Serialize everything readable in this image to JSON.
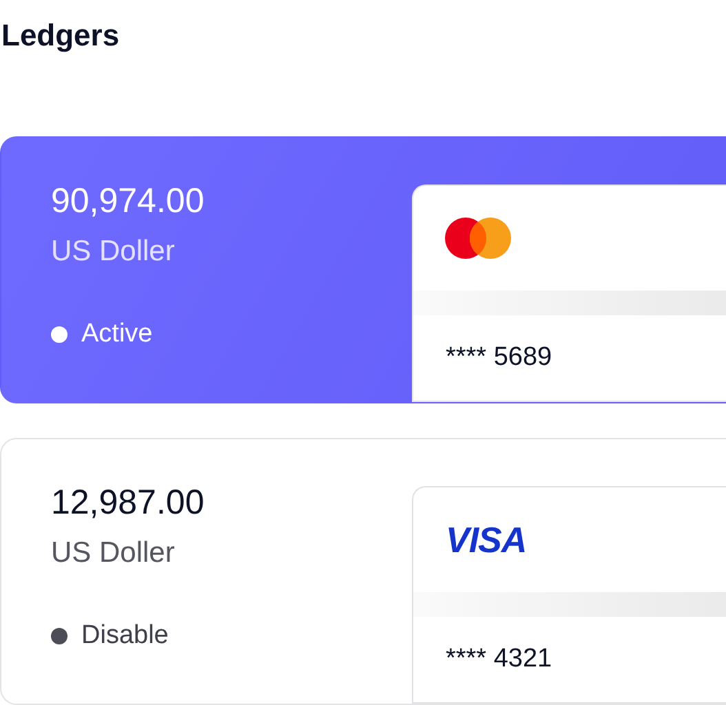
{
  "title": "Ledgers",
  "ledgers": [
    {
      "amount": "90,974.00",
      "currency": "US Doller",
      "status": "Active",
      "selected": true,
      "card": {
        "kind": "mastercard",
        "number": "**** 5689"
      }
    },
    {
      "amount": "12,987.00",
      "currency": "US Doller",
      "status": "Disable",
      "selected": false,
      "card": {
        "kind": "visa",
        "logo_text": "VISA",
        "number": "**** 4321"
      }
    }
  ]
}
